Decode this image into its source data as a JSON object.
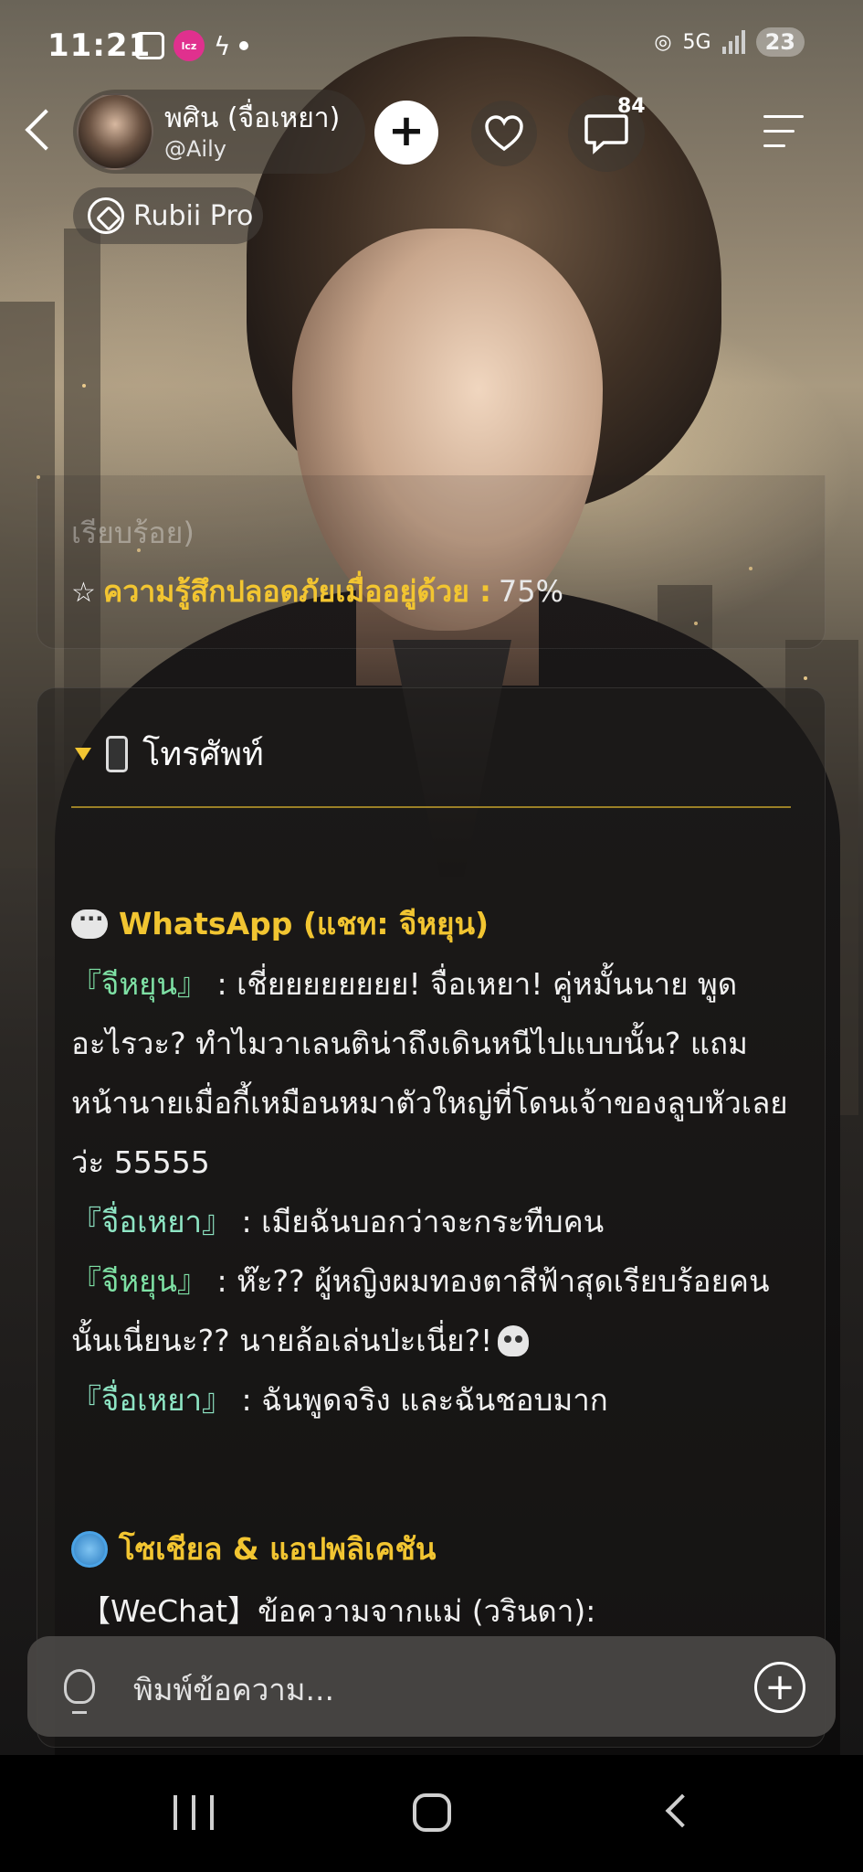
{
  "status_bar": {
    "time": "11:21",
    "app_badge": "lcz",
    "network": "5G",
    "battery": "23"
  },
  "header": {
    "profile_name": "พศิน (จื่อเหยา)",
    "profile_handle": "@Aily",
    "message_count": "84",
    "pro_label": "Rubii Pro"
  },
  "upper_card": {
    "faded_text": "เรียบร้อย)",
    "stat_star": "☆",
    "stat_label": "ความรู้สึกปลอดภัยเมื่ออยู่ด้วย :",
    "stat_value": "75%"
  },
  "phone_section": {
    "title": "โทรศัพท์",
    "whatsapp_header": "WhatsApp (แชท: จีหยุน)",
    "chat": [
      {
        "speaker": "『จีหยุน』",
        "text": " : เชี่ยยยยยยยย! จื่อเหยา! คู่หมั้นนาย พูดอะไรวะ? ทำไมวาเลนติน่าถึงเดินหนีไปแบบนั้น? แถมหน้านายเมื่อกี้เหมือนหมาตัวใหญ่ที่โดนเจ้าของลูบหัวเลยว่ะ 55555"
      },
      {
        "speaker": "『จื่อเหยา』",
        "text": " : เมียฉันบอกว่าจะกระทืบคน"
      },
      {
        "speaker": "『จีหยุน』",
        "text": " : ห๊ะ?? ผู้หญิงผมทองตาสีฟ้าสุดเรียบร้อยคนนั้นเนี่ยนะ?? นายล้อเล่นป่ะเนี่ย?!"
      },
      {
        "speaker": "『จื่อเหยา』",
        "text": " : ฉันพูดจริง และฉันชอบมาก"
      }
    ],
    "social_header": "โซเชียล & แอปพลิเคชัน",
    "wechat_line": "【WeChat】ข้อความจากแม่ (วรินดา):"
  },
  "input": {
    "placeholder": "พิมพ์ข้อความ..."
  }
}
